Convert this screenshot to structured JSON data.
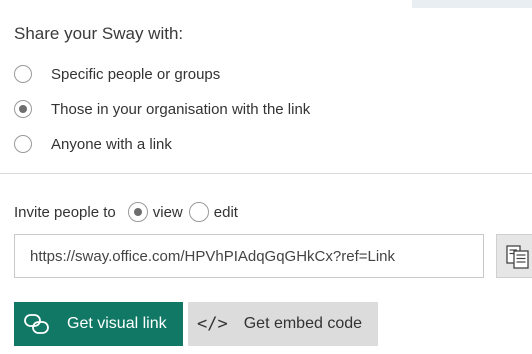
{
  "share": {
    "heading": "Share your Sway with:",
    "options": [
      {
        "label": "Specific people or groups",
        "selected": false
      },
      {
        "label": "Those in your organisation with the link",
        "selected": true
      },
      {
        "label": "Anyone with a link",
        "selected": false
      }
    ]
  },
  "invite": {
    "label": "Invite people to",
    "view_label": "view",
    "edit_label": "edit",
    "selected": "view"
  },
  "link": {
    "value": "https://sway.office.com/HPVhPIAdqGqGHkCx?ref=Link"
  },
  "buttons": {
    "visual_link_label": "Get visual link",
    "embed_code_label": "Get embed code",
    "embed_icon_glyph": "</>",
    "visual_icon": "link-icon",
    "copy_icon": "copy-icon"
  },
  "colors": {
    "primary": "#117865",
    "secondary_button": "#dcdcdc"
  }
}
